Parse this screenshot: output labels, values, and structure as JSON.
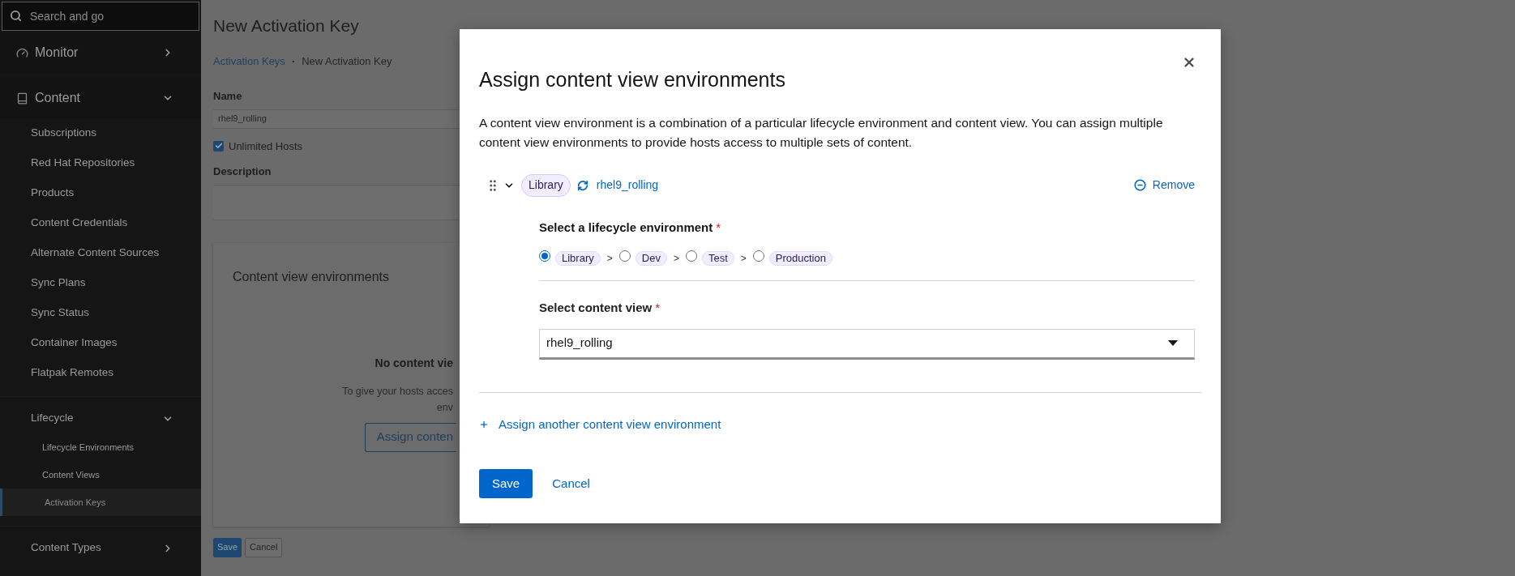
{
  "sidebar": {
    "search_placeholder": "Search and go",
    "items": [
      {
        "label": "Monitor",
        "expanded": false
      },
      {
        "label": "Content",
        "expanded": true,
        "children": [
          {
            "label": "Subscriptions",
            "selected": false
          },
          {
            "label": "Red Hat Repositories",
            "selected": false
          },
          {
            "label": "Products",
            "selected": false
          },
          {
            "label": "Content Credentials",
            "selected": false
          },
          {
            "label": "Alternate Content Sources",
            "selected": false
          },
          {
            "label": "Sync Plans",
            "selected": false
          },
          {
            "label": "Sync Status",
            "selected": false
          },
          {
            "label": "Container Images",
            "selected": false
          },
          {
            "label": "Flatpak Remotes",
            "selected": false
          },
          {
            "label": "Lifecycle",
            "expanded": true,
            "children": [
              {
                "label": "Lifecycle Environments",
                "selected": false
              },
              {
                "label": "Content Views",
                "selected": false
              },
              {
                "label": "Activation Keys",
                "selected": true
              }
            ]
          },
          {
            "label": "Content Types",
            "expanded": false
          }
        ]
      }
    ]
  },
  "page": {
    "title": "New Activation Key",
    "breadcrumb": [
      {
        "label": "Activation Keys",
        "kind": "link"
      },
      {
        "label": "·",
        "kind": "separator"
      },
      {
        "label": "New Activation Key",
        "kind": "current"
      }
    ],
    "name_label": "Name",
    "name_value": "rhel9_rolling",
    "unlimited_hosts": {
      "label": "Unlimited Hosts",
      "checked": true
    },
    "description_label": "Description",
    "card": {
      "title": "Content view environments",
      "empty_title": "No content vie",
      "empty_lines": [
        "To give your hosts acces",
        "env"
      ],
      "button": "Assign conten"
    },
    "buttons": [
      {
        "label": "Save",
        "kind": "primary"
      },
      {
        "label": "Cancel",
        "kind": "secondary"
      }
    ]
  },
  "modal": {
    "title": "Assign content view environments",
    "description": "A content view environment is a combination of a particular lifecycle environment and content view. You can assign multiple content view environments to provide hosts access to multiple sets of content.",
    "entry": {
      "expanded": true,
      "environment": "Library",
      "content_view": "rhel9_rolling",
      "remove": "Remove",
      "lifecycle_label": "Select a lifecycle environment",
      "lifecycle_required_mark": "*",
      "separator": ">",
      "environments": [
        {
          "label": "Library",
          "selected": true
        },
        {
          "label": "Dev",
          "selected": false
        },
        {
          "label": "Test",
          "selected": false
        },
        {
          "label": "Production",
          "selected": false
        }
      ],
      "content_view_label": "Select content view",
      "content_view_required_mark": "*",
      "content_view_value": "rhel9_rolling"
    },
    "add_link": "Assign another content view environment",
    "buttons": [
      {
        "label": "Save",
        "kind": "primary"
      },
      {
        "label": "Cancel",
        "kind": "link"
      }
    ]
  }
}
